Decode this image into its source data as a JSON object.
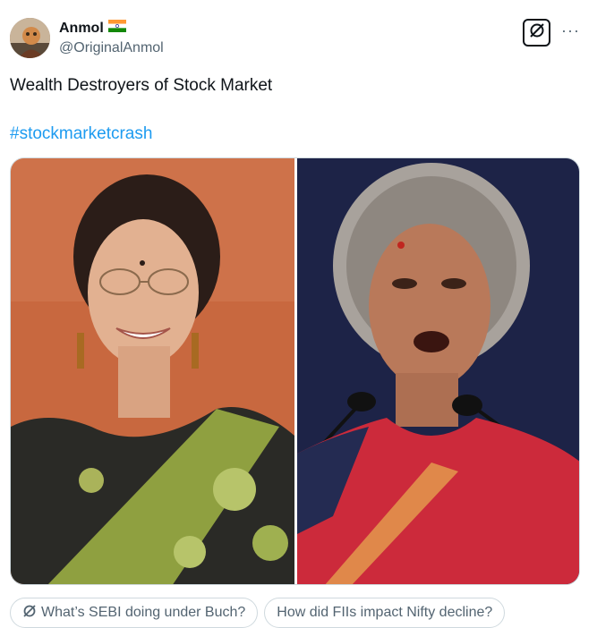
{
  "author": {
    "display_name": "Anmol",
    "handle": "@OriginalAnmol",
    "flag": "india-flag"
  },
  "tweet": {
    "text": "Wealth Destroyers of Stock Market",
    "hashtag": "#stockmarketcrash"
  },
  "actions": {
    "grok_icon": "grok-icon",
    "more": "···"
  },
  "media": {
    "left_photo": "woman in green and black saree smiling",
    "right_photo": "woman in red saree speaking at microphone"
  },
  "suggested_questions": [
    {
      "label": "What’s SEBI doing under Buch?",
      "has_icon": true
    },
    {
      "label": "How did FIIs impact Nifty decline?",
      "has_icon": false
    }
  ],
  "colors": {
    "link": "#1d9bf0",
    "secondary_text": "#536471"
  }
}
